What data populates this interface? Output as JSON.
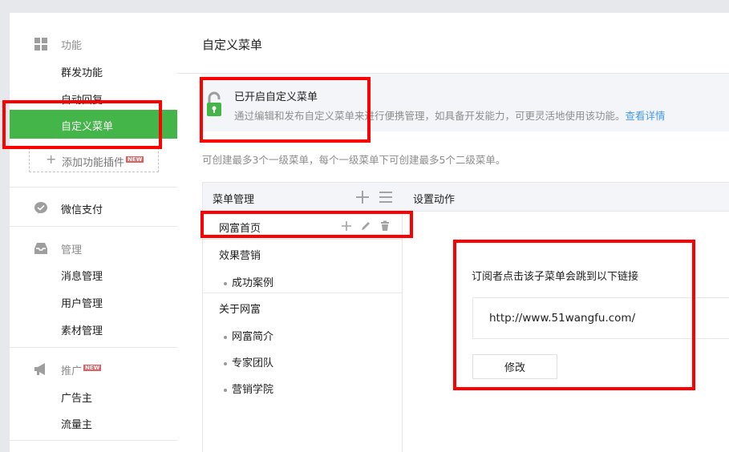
{
  "sidebar": {
    "sections": [
      {
        "title": "功能",
        "icon": "grid-icon"
      },
      {
        "title": "微信支付",
        "icon": "wechat-pay-icon"
      },
      {
        "title": "管理",
        "icon": "inbox-icon"
      },
      {
        "title": "推广",
        "icon": "megaphone-icon",
        "badge": "NEW"
      }
    ],
    "function_items": [
      "群发功能",
      "自动回复",
      "自定义菜单"
    ],
    "add_plugin_label": "添加功能插件",
    "add_plugin_badge": "NEW",
    "manage_items": [
      "消息管理",
      "用户管理",
      "素材管理"
    ],
    "promo_items": [
      "广告主",
      "流量主"
    ]
  },
  "main": {
    "page_title": "自定义菜单",
    "notice": {
      "title": "已开启自定义菜单",
      "desc": "通过编辑和发布自定义菜单来进行便携管理，如具备开发能力，可更灵活地使用该功能。",
      "link": "查看详情"
    },
    "info": "可创建最多3个一级菜单，每个一级菜单下可创建最多5个二级菜单。",
    "menu_panel": {
      "title": "菜单管理",
      "items": [
        {
          "label": "网富首页"
        },
        {
          "label": "效果营销",
          "children": [
            "成功案例"
          ]
        },
        {
          "label": "关于网富",
          "children": [
            "网富简介",
            "专家团队",
            "营销学院"
          ]
        }
      ]
    },
    "action_panel": {
      "title": "设置动作",
      "jump_label": "订阅者点击该子菜单会跳到以下链接",
      "url": "http://www.51wangfu.com/",
      "modify_button": "修改"
    }
  },
  "colors": {
    "accent_green": "#44b549",
    "link_blue": "#459ae9",
    "annotation_red": "#ff0000",
    "new_badge": "#e15f63"
  }
}
